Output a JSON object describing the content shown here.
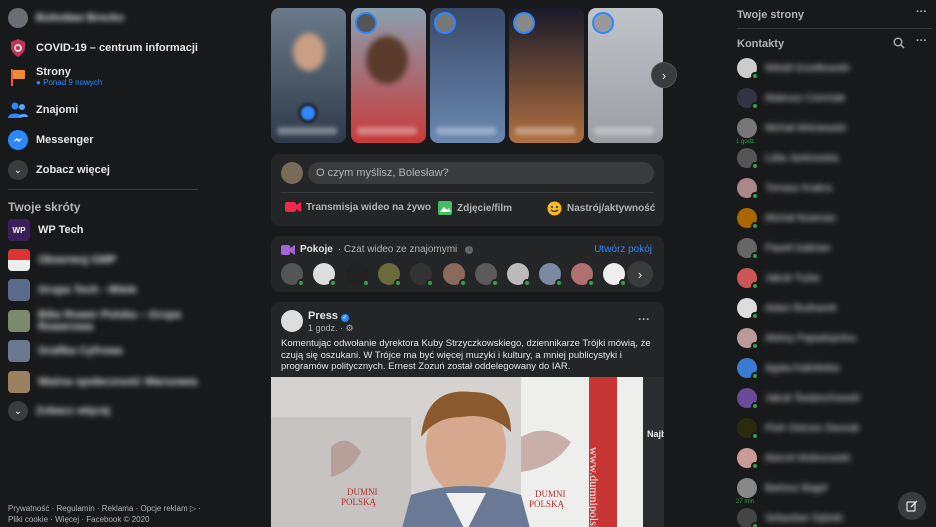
{
  "left_nav": {
    "profile_name": "Bolesław Brecko",
    "items": [
      {
        "label": "COVID-19 – centrum informacji",
        "icon": "shield-icon",
        "color": "#c0365a"
      },
      {
        "label": "Strony",
        "sub": "Ponad 9 nowych",
        "icon": "flag-icon",
        "color": "#e8632f"
      },
      {
        "label": "Znajomi",
        "icon": "friends-icon",
        "color": "#2d88ff"
      },
      {
        "label": "Messenger",
        "icon": "messenger-icon",
        "color": "#2d88ff"
      },
      {
        "label": "Zobacz więcej",
        "icon": "chevron-down-icon",
        "color": "#3a3b3c"
      }
    ],
    "shortcuts_title": "Twoje skróty",
    "shortcuts": [
      {
        "label": "WP Tech",
        "icon": "wp-tech-logo"
      },
      {
        "label": "Obserwuj GMP"
      },
      {
        "label": "Grupa Tech - Wiele"
      },
      {
        "label": "Bike Rower Polska – Grupa Rowerowa"
      },
      {
        "label": "Grafika Cyfrowa"
      },
      {
        "label": "Ważna społeczność Warszawa"
      }
    ],
    "more_label": "Zobacz więcej",
    "footer": "Prywatność · Regulamin · Reklama · Opcje reklam ▷ · Pliki cookie · Więcej · Facebook © 2020"
  },
  "stories": {
    "items": [
      {
        "caption": "Utwórz relację",
        "color": "#3d4a5a"
      },
      {
        "caption": "Relacja",
        "color": "#b43a3a"
      },
      {
        "caption": "Relacja",
        "color": "#3a5a8a"
      },
      {
        "caption": "Relacja",
        "color": "#8a5a3a"
      },
      {
        "caption": "Relacja",
        "color": "#c8c8c8"
      }
    ],
    "next_icon": "chevron-right-icon"
  },
  "composer": {
    "placeholder": "O czym myślisz, Bolesław?",
    "actions": [
      {
        "label": "Transmisja wideo na żywo",
        "icon": "live-video-icon",
        "color": "#f02849"
      },
      {
        "label": "Zdjęcie/film",
        "icon": "photo-icon",
        "color": "#45bd62"
      },
      {
        "label": "Nastrój/aktywność",
        "icon": "smiley-icon",
        "color": "#f7b928"
      }
    ]
  },
  "rooms": {
    "title": "Pokoje",
    "subtitle": " · Czat wideo ze znajomymi",
    "create_label": "Utwórz pokój",
    "next_icon": "chevron-right-icon"
  },
  "post": {
    "author": "Press",
    "time": "1 godz. ·",
    "text": "Komentując odwołanie dyrektora Kuby Strzyczkowskiego, dziennikarze Trójki mówią, że czują się oszukani. W Trójce ma być więcej muzyki i kultury, a mniej publicystyki i programów politycznych. Ernest Zozuń został oddelegowany do IAR.",
    "image_text": [
      "DUMNI",
      "POLSKĄ",
      "www.dumnipolską",
      "Najb"
    ]
  },
  "right": {
    "pages_title": "Twoje strony",
    "contacts_title": "Kontakty",
    "contacts": [
      {
        "name": "Witold Grzelkowski"
      },
      {
        "name": "Mateusz Czerniak"
      },
      {
        "name": "Michał Wiśniewski",
        "badge": "1 godz."
      },
      {
        "name": "Lidia Jankowska"
      },
      {
        "name": "Tomasz Krakra"
      },
      {
        "name": "Michał Nowman"
      },
      {
        "name": "Paweł Gabrian"
      },
      {
        "name": "Jakub Tryba"
      },
      {
        "name": "Adam Bodnarek"
      },
      {
        "name": "Aleksy Papadopolou"
      },
      {
        "name": "Agata Kalinkieka"
      },
      {
        "name": "Jakub Świętochowski"
      },
      {
        "name": "Piotr Ostrzec Dworak"
      },
      {
        "name": "Marcel Wołosowski"
      },
      {
        "name": "Bartosz Bagel",
        "badge": "27 min"
      },
      {
        "name": "Sebastian Dębski"
      }
    ],
    "new_message_icon": "compose-icon"
  }
}
